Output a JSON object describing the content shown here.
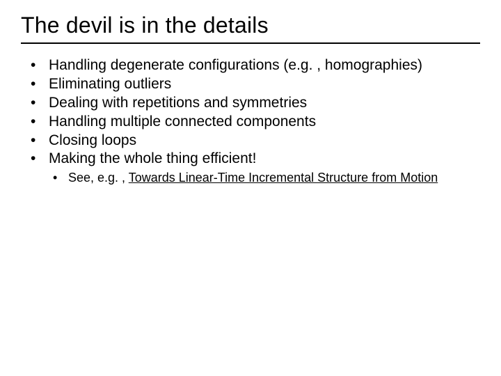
{
  "title": "The devil is in the details",
  "bullets": [
    "Handling degenerate configurations (e.g. , homographies)",
    "Eliminating outliers",
    "Dealing with repetitions and symmetries",
    "Handling multiple connected components",
    "Closing loops",
    "Making the whole thing efficient!"
  ],
  "sub": {
    "prefix": "See, e.g. , ",
    "link": "Towards Linear-Time Incremental Structure from Motion"
  }
}
